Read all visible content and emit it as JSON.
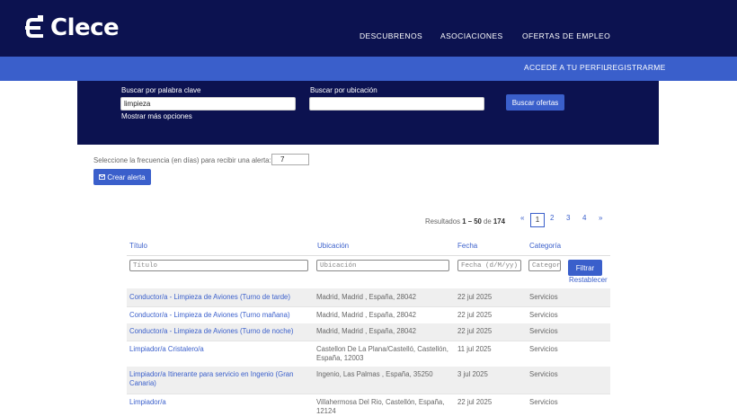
{
  "header": {
    "brand": "Clece",
    "nav": [
      "DESCUBRENOS",
      "ASOCIACIONES",
      "OFERTAS DE EMPLEO"
    ],
    "account": [
      "ACCEDE A TU PERFIL",
      "REGISTRARME"
    ]
  },
  "search": {
    "keyword_label": "Buscar por palabra clave",
    "keyword_value": "limpieza",
    "location_label": "Buscar por ubicación",
    "location_value": "",
    "more_options": "Mostrar más opciones",
    "submit": "Buscar ofertas"
  },
  "alert": {
    "label": "Seleccione la frecuencia (en días) para recibir una alerta:",
    "frequency": "7",
    "button": "Crear alerta"
  },
  "results": {
    "prefix": "Resultados ",
    "range": "1 – 50",
    "of": " de ",
    "total": "174",
    "pages": [
      "«",
      "1",
      "2",
      "3",
      "4",
      "»"
    ],
    "current_page": "1"
  },
  "table": {
    "headers": [
      "Título",
      "Ubicación",
      "Fecha",
      "Categoría"
    ],
    "filters": [
      "Título",
      "Ubicación",
      "Fecha (d/M/yy)",
      "Categoría"
    ],
    "filter_button": "Filtrar",
    "reset": "Restablecer",
    "rows": [
      {
        "title": "Conductor/a - Limpieza de Aviones (Turno de tarde)",
        "location": "Madrid, Madrid , España, 28042",
        "date": "22 jul 2025",
        "category": "Servicios"
      },
      {
        "title": "Conductor/a - Limpieza de Aviones (Turno mañana)",
        "location": "Madrid, Madrid , España, 28042",
        "date": "22 jul 2025",
        "category": "Servicios"
      },
      {
        "title": "Conductor/a - Limpieza de Aviones (Turno de noche)",
        "location": "Madrid, Madrid , España, 28042",
        "date": "22 jul 2025",
        "category": "Servicios"
      },
      {
        "title": "Limpiador/a Cristalero/a",
        "location": "Castellon De La Plana/Castelló, Castellón, España, 12003",
        "date": "11 jul 2025",
        "category": "Servicios"
      },
      {
        "title": "Limpiador/a Itinerante para servicio en Ingenio (Gran Canaria)",
        "location": "Ingenio, Las Palmas , España, 35250",
        "date": "3 jul 2025",
        "category": "Servicios"
      },
      {
        "title": "Limpiador/a",
        "location": "Villahermosa Del Rio, Castellón, España, 12124",
        "date": "22 jul 2025",
        "category": "Servicios"
      }
    ]
  },
  "colors": {
    "navy": "#0c1250",
    "accent": "#3a5fcb"
  }
}
